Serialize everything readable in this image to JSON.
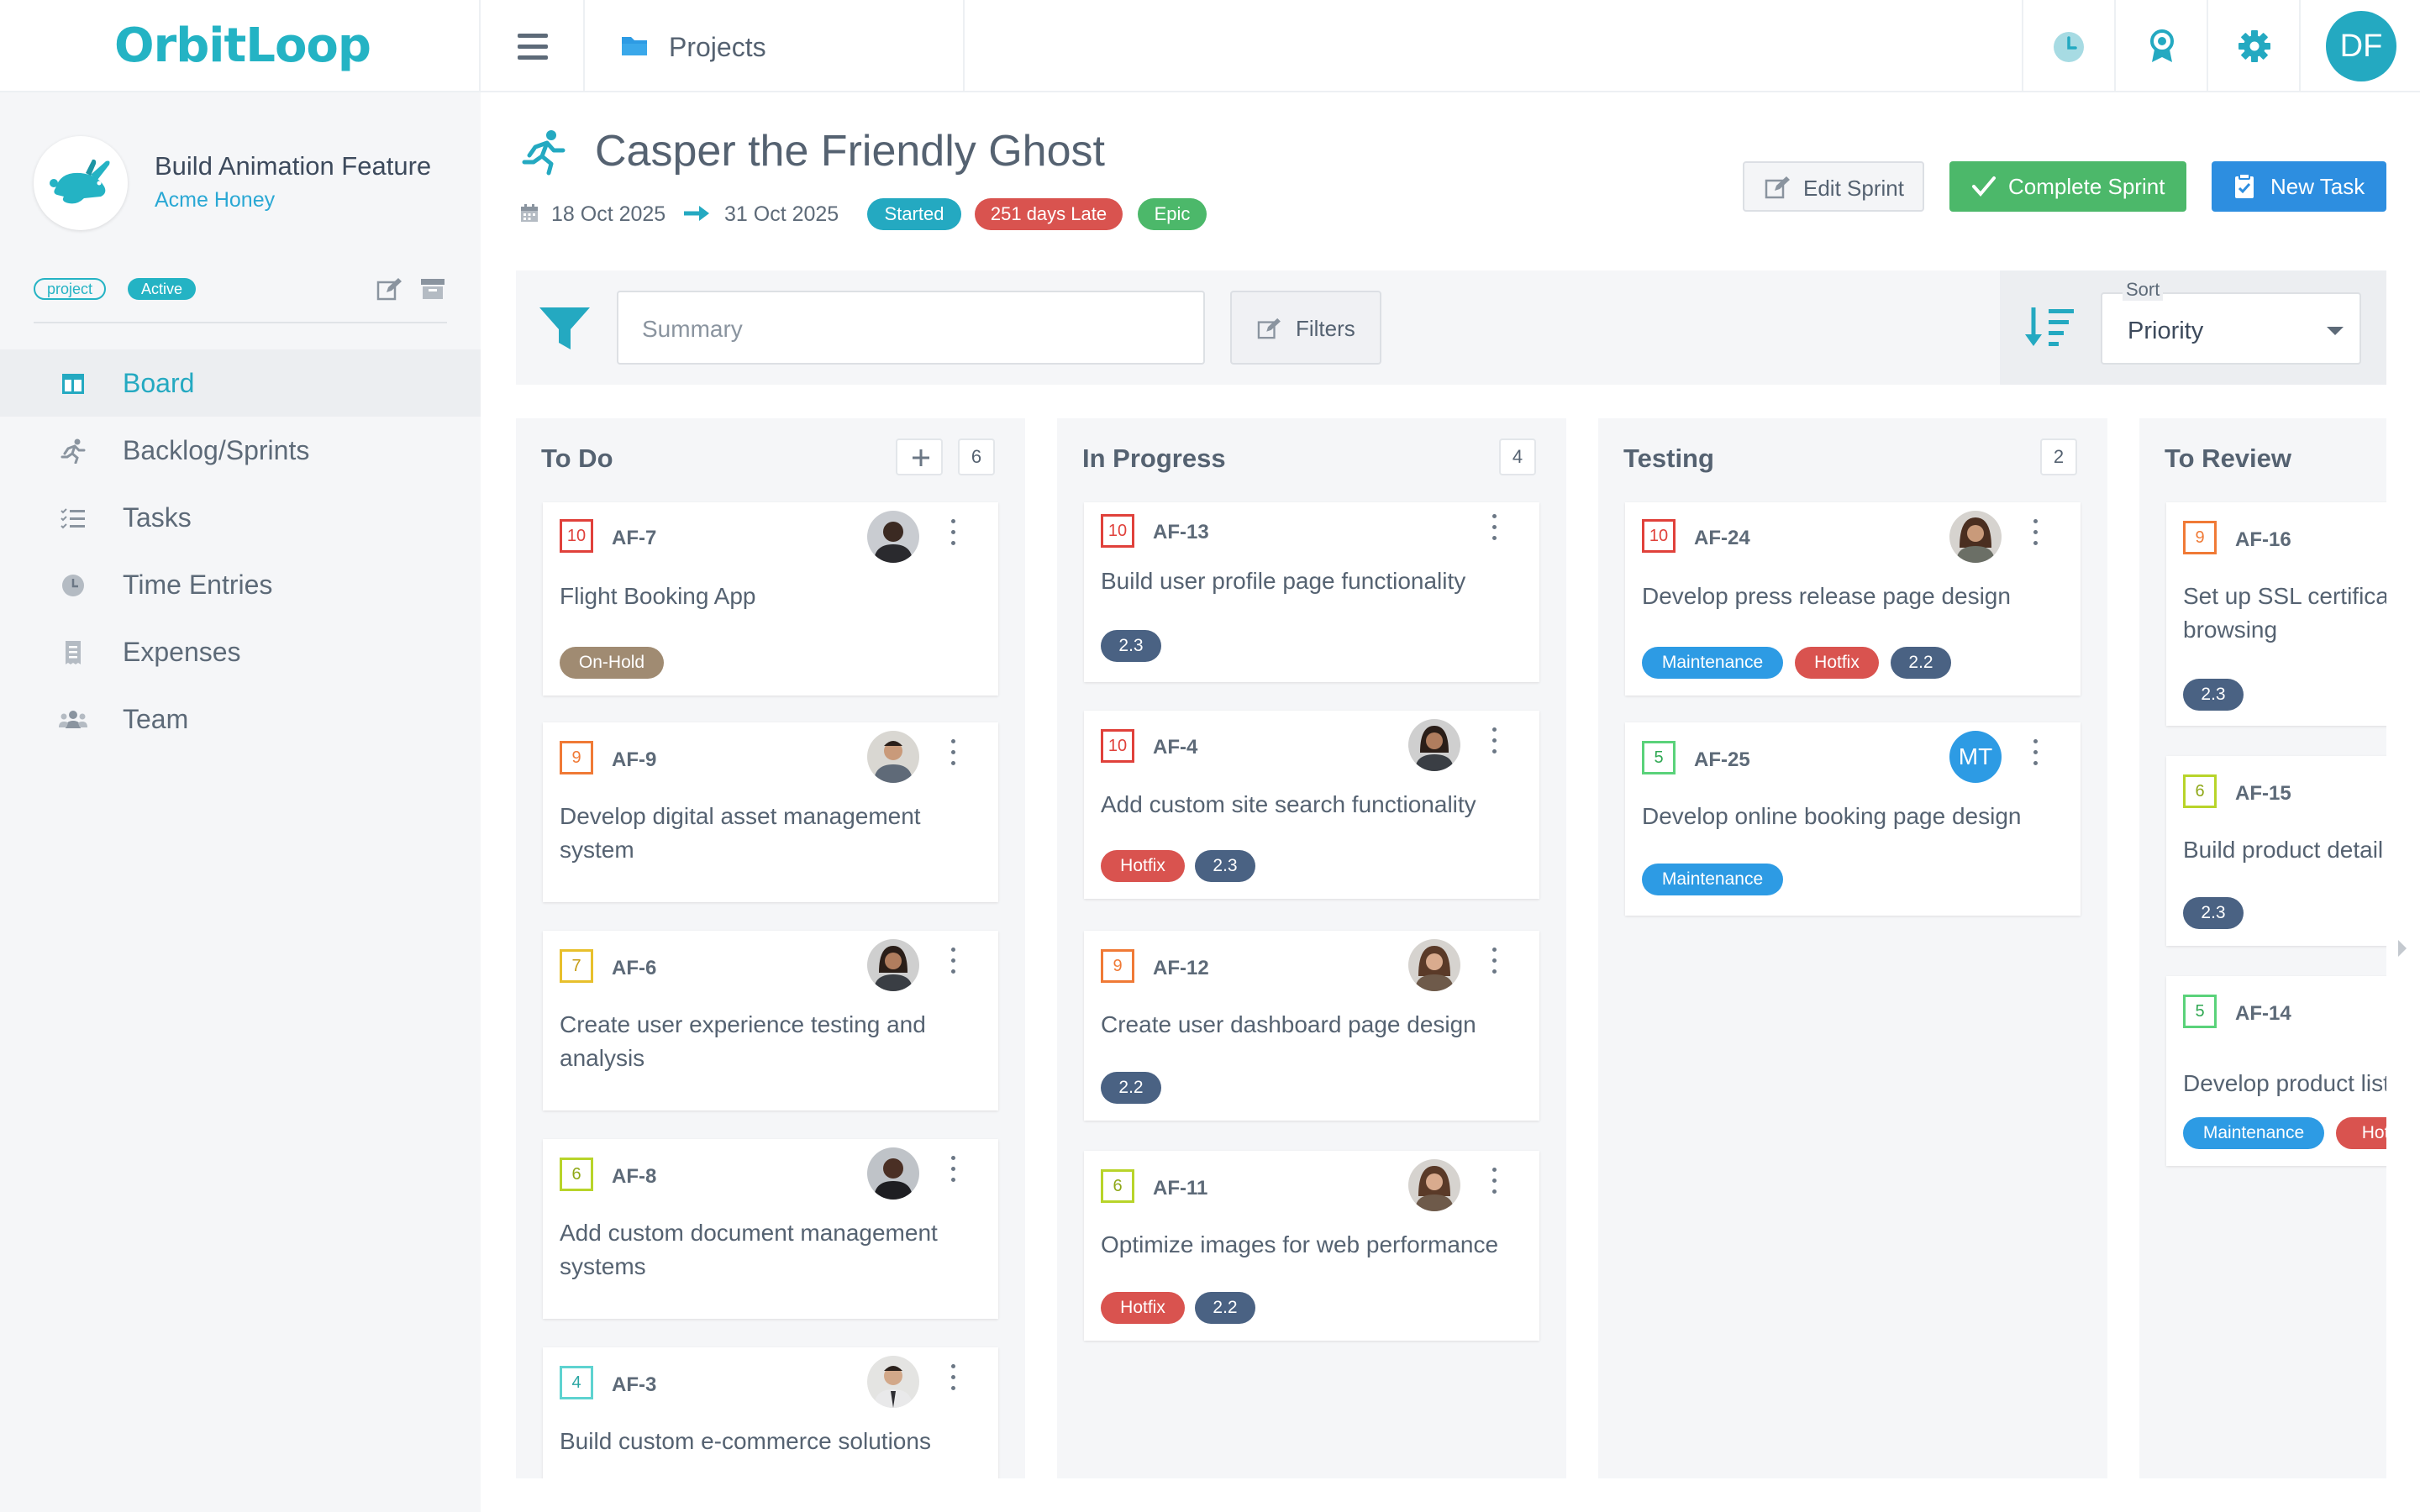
{
  "app": {
    "logo": "OrbitLoop",
    "breadcrumb": "Projects",
    "user_initials": "DF"
  },
  "topbar": {
    "icons": [
      "menu-icon",
      "folder-icon",
      "clock-icon",
      "award-icon",
      "gear-icon"
    ]
  },
  "project": {
    "name": "Build Animation Feature",
    "client": "Acme Honey",
    "type_tag": "project",
    "status_tag": "Active"
  },
  "nav": [
    {
      "label": "Board",
      "icon": "board-icon",
      "active": true
    },
    {
      "label": "Backlog/Sprints",
      "icon": "sprint-runner-icon"
    },
    {
      "label": "Tasks",
      "icon": "tasks-list-icon"
    },
    {
      "label": "Time Entries",
      "icon": "clock-icon"
    },
    {
      "label": "Expenses",
      "icon": "receipt-icon"
    },
    {
      "label": "Team",
      "icon": "team-icon"
    }
  ],
  "sprint": {
    "title": "Casper the Friendly Ghost",
    "start": "18 Oct 2025",
    "end": "31 Oct 2025",
    "status": "Started",
    "late": "251 days Late",
    "kind": "Epic"
  },
  "actions": {
    "edit": "Edit Sprint",
    "complete": "Complete Sprint",
    "new_task": "New Task"
  },
  "filter": {
    "placeholder": "Summary",
    "filters_label": "Filters",
    "sort_caption": "Sort",
    "sort_value": "Priority"
  },
  "colors": {
    "accent": "#24b3c4",
    "hotfix": "#d9534f",
    "version": "#4a6283",
    "maintenance": "#2d9be4",
    "onhold": "#a08b72",
    "green": "#4cb86a",
    "blue": "#2d8ee0"
  },
  "columns": [
    {
      "title": "To Do",
      "count": "6",
      "cards": [
        {
          "prio": "10",
          "key": "AF-7",
          "title": "Flight Booking App",
          "tags": [
            "On-Hold"
          ]
        },
        {
          "prio": "9",
          "key": "AF-9",
          "title": "Develop digital asset management system",
          "tags": []
        },
        {
          "prio": "7",
          "key": "AF-6",
          "title": "Create user experience testing and analysis",
          "tags": []
        },
        {
          "prio": "6",
          "key": "AF-8",
          "title": "Add custom document management systems",
          "tags": []
        },
        {
          "prio": "4",
          "key": "AF-3",
          "title": "Build custom e-commerce solutions",
          "tags": []
        }
      ]
    },
    {
      "title": "In Progress",
      "count": "4",
      "cards": [
        {
          "prio": "10",
          "key": "AF-13",
          "title": "Build user profile page functionality",
          "tags": [
            "2.3"
          ]
        },
        {
          "prio": "10",
          "key": "AF-4",
          "title": "Add custom site search functionality",
          "tags": [
            "Hotfix",
            "2.3"
          ]
        },
        {
          "prio": "9",
          "key": "AF-12",
          "title": "Create user dashboard page design",
          "tags": [
            "2.2"
          ]
        },
        {
          "prio": "6",
          "key": "AF-11",
          "title": "Optimize images for web performance",
          "tags": [
            "Hotfix",
            "2.2"
          ]
        }
      ]
    },
    {
      "title": "Testing",
      "count": "2",
      "cards": [
        {
          "prio": "10",
          "key": "AF-24",
          "title": "Develop press release page design",
          "tags": [
            "Maintenance",
            "Hotfix",
            "2.2"
          ]
        },
        {
          "prio": "5",
          "key": "AF-25",
          "title": "Develop online booking page design",
          "tags": [
            "Maintenance"
          ],
          "avatar_initials": "MT"
        }
      ]
    },
    {
      "title": "To Review",
      "cards": [
        {
          "prio": "9",
          "key": "AF-16",
          "title_lines": [
            "Set up SSL certifica",
            "browsing"
          ],
          "tags": [
            "2.3"
          ]
        },
        {
          "prio": "6",
          "key": "AF-15",
          "title": "Build product detail",
          "tags": [
            "2.3"
          ]
        },
        {
          "prio": "5",
          "key": "AF-14",
          "title": "Develop product list",
          "tags": [
            "Maintenance",
            "Hotf"
          ]
        }
      ]
    }
  ]
}
